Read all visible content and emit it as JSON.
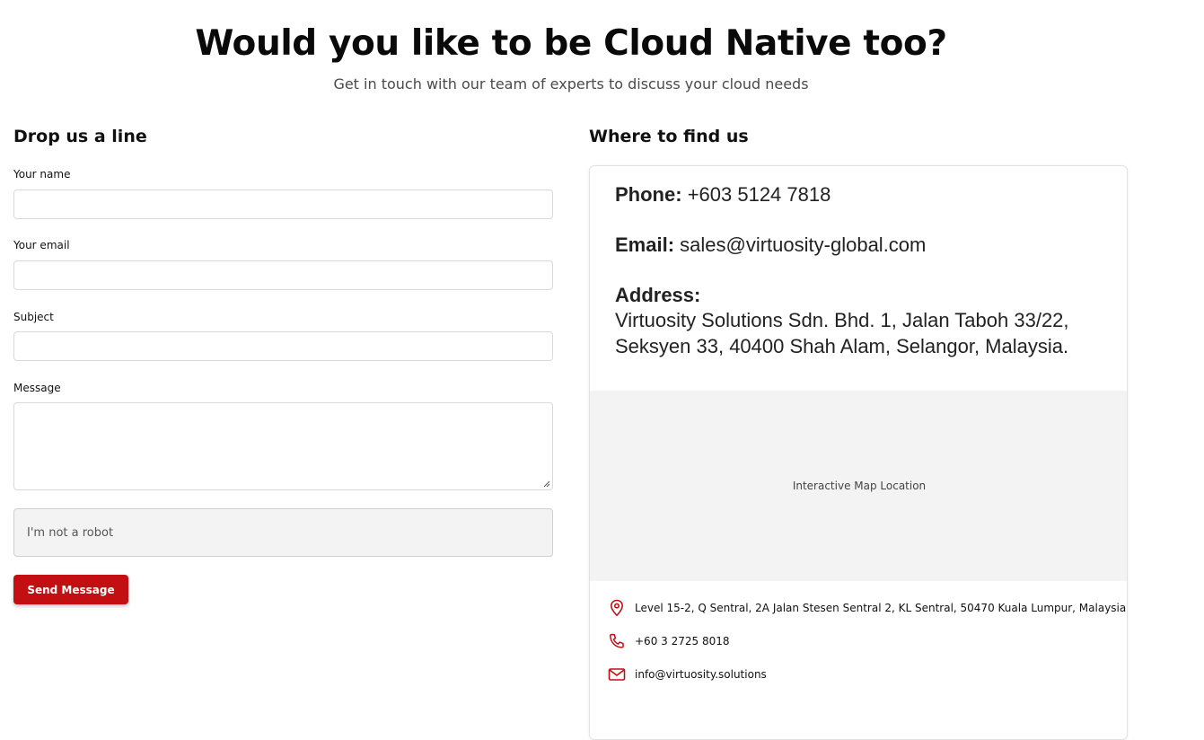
{
  "hero": {
    "title": "Would you like to be Cloud Native too?",
    "subtitle": "Get in touch with our team of experts to discuss your cloud needs"
  },
  "form": {
    "heading": "Drop us a line",
    "name_label": "Your name",
    "email_label": "Your email",
    "subject_label": "Subject",
    "message_label": "Message",
    "name_value": "",
    "email_value": "",
    "subject_value": "",
    "message_value": "",
    "captcha_label": "I'm not a robot",
    "submit_label": "Send Message"
  },
  "location": {
    "heading": "Where to find us",
    "phone_label": "Phone:",
    "phone_value": "+603 5124 7818",
    "email_label": "Email:",
    "email_value": "sales@virtuosity-global.com",
    "address_label": "Address:",
    "address_line1": "Virtuosity Solutions Sdn. Bhd. 1, Jalan Taboh 33/22,",
    "address_line2": "Seksyen 33, 40400 Shah Alam, Selangor, Malaysia.",
    "map_placeholder": "Interactive Map Location",
    "details": [
      {
        "icon": "map-pin-icon",
        "text": "Level 15-2, Q Sentral, 2A Jalan Stesen Sentral 2, KL Sentral, 50470 Kuala Lumpur, Malaysia"
      },
      {
        "icon": "phone-icon",
        "text": "+60 3 2725 8018"
      },
      {
        "icon": "mail-icon",
        "text": "info@virtuosity.solutions"
      }
    ]
  },
  "colors": {
    "accent": "#c30f12",
    "map_bg": "#f3f3f3"
  }
}
